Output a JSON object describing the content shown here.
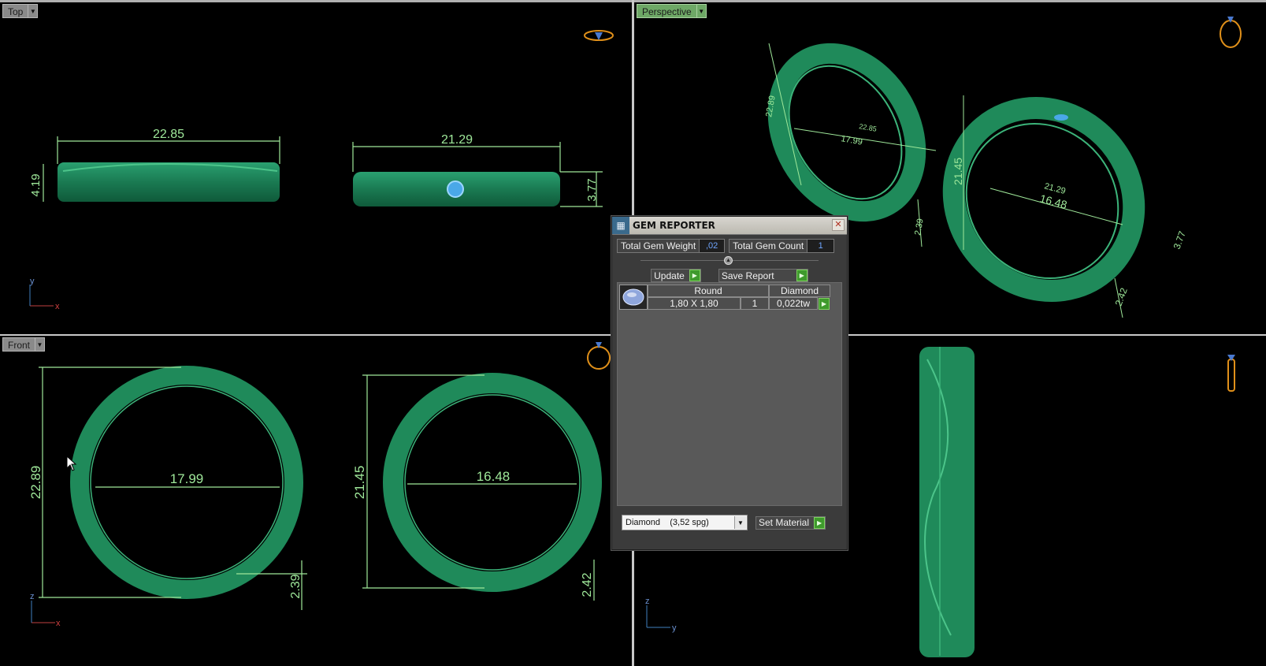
{
  "viewports": {
    "top": {
      "label": "Top",
      "dims": {
        "ring1_width": "22.85",
        "ring1_height": "4.19",
        "ring2_width": "21.29",
        "ring2_height": "3.77"
      },
      "axes": {
        "v": "y",
        "h": "x"
      }
    },
    "perspective": {
      "label": "Perspective",
      "dims": {
        "r1_outer": "22.89",
        "r1_inner": "17.99",
        "r1_inner2": "22.85",
        "r1_thick": "2.39",
        "r2_outer": "21.45",
        "r2_inner": "16.48",
        "r2_inner2": "21.29",
        "r2_height": "3.77",
        "r2_thick": "2.42"
      }
    },
    "front": {
      "label": "Front",
      "dims": {
        "ring1_outer": "22.89",
        "ring1_inner": "17.99",
        "ring1_thick": "2.39",
        "ring2_outer": "21.45",
        "ring2_inner": "16.48",
        "ring2_thick": "2.42"
      },
      "axes": {
        "v": "z",
        "h": "x"
      }
    },
    "right": {
      "axes": {
        "v": "z",
        "h": "y"
      }
    }
  },
  "dialog": {
    "title": "GEM REPORTER",
    "close_glyph": "✕",
    "total_weight_label": "Total Gem Weight",
    "total_weight_value": ",02",
    "total_count_label": "Total Gem Count",
    "total_count_value": "1",
    "update_label": "Update",
    "save_report_label": "Save Report",
    "gem_table": {
      "header_shape": "Round",
      "header_material": "Diamond",
      "size": "1,80 X 1,80",
      "count": "1",
      "weight": "0,022tw"
    },
    "material_select": "Diamond    (3,52 spg)",
    "set_material_label": "Set Material"
  },
  "colors": {
    "ring_green": "#1f8a5a",
    "dim_line": "#9fe89a",
    "gem_blue": "#4aa8e8"
  }
}
